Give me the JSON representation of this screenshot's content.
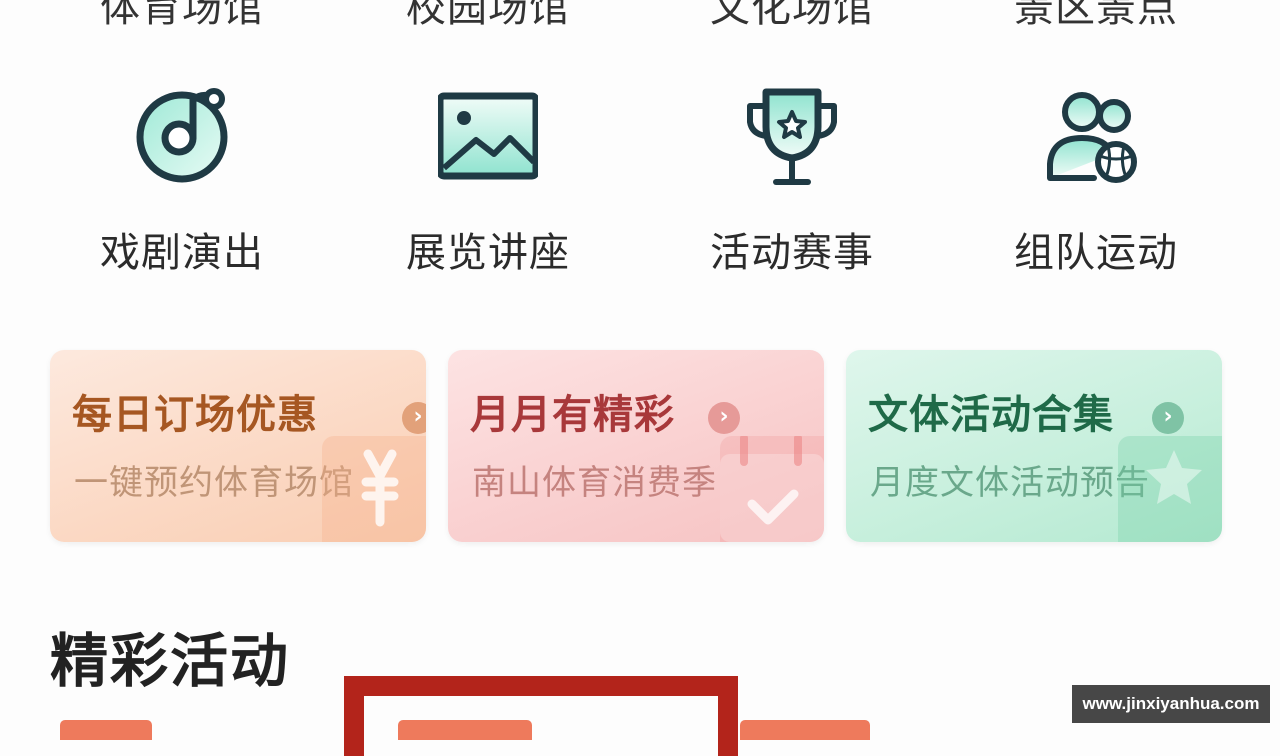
{
  "top_categories": [
    "体育场馆",
    "校园场馆",
    "文化场馆",
    "景区景点"
  ],
  "categories": [
    {
      "label": "戏剧演出",
      "icon": "music-disc-icon"
    },
    {
      "label": "展览讲座",
      "icon": "landscape-picture-icon"
    },
    {
      "label": "活动赛事",
      "icon": "trophy-star-icon"
    },
    {
      "label": "组队运动",
      "icon": "team-ball-icon"
    }
  ],
  "promo_cards": [
    {
      "title": "每日订场优惠",
      "subtitle": "一键预约体育场馆",
      "icon": "yen-coupon-icon"
    },
    {
      "title": "月月有精彩",
      "subtitle": "南山体育消费季",
      "icon": "calendar-check-icon"
    },
    {
      "title": "文体活动合集",
      "subtitle": "月度文体活动预告",
      "icon": "star-badge-icon"
    }
  ],
  "section": {
    "title": "精彩活动"
  },
  "watermark": "www.jinxiyanhua.com",
  "colors": {
    "icon_stroke": "#1f3a44",
    "icon_fill": "#7fdac6",
    "highlight_frame": "#b3241b",
    "tag": "#ee7a5c"
  }
}
